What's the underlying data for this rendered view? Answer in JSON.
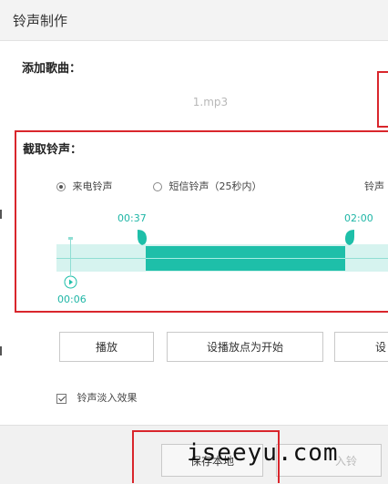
{
  "window": {
    "title": "铃声制作"
  },
  "add_song": {
    "label": "添加歌曲：",
    "filename": "1.mp3"
  },
  "clip": {
    "label": "截取铃声：",
    "options": [
      {
        "label": "来电铃声",
        "selected": true
      },
      {
        "label": "短信铃声（25秒内）",
        "selected": false
      },
      {
        "label": "铃声",
        "selected": false
      }
    ],
    "start_time": "00:37",
    "end_time": "02:00",
    "playhead_time": "00:06",
    "selection_fraction": [
      0.168,
      0.568
    ]
  },
  "buttons": {
    "play": "播放",
    "set_start": "设播放点为开始",
    "set_end": "设"
  },
  "fade_in": {
    "label": "铃声淡入效果",
    "checked": true
  },
  "footer": {
    "save": "保存本地",
    "secondary": "入铃",
    "watermark": "iseeyu.com"
  },
  "colors": {
    "accent": "#1ebfa9",
    "highlight_box": "#d9262c"
  }
}
